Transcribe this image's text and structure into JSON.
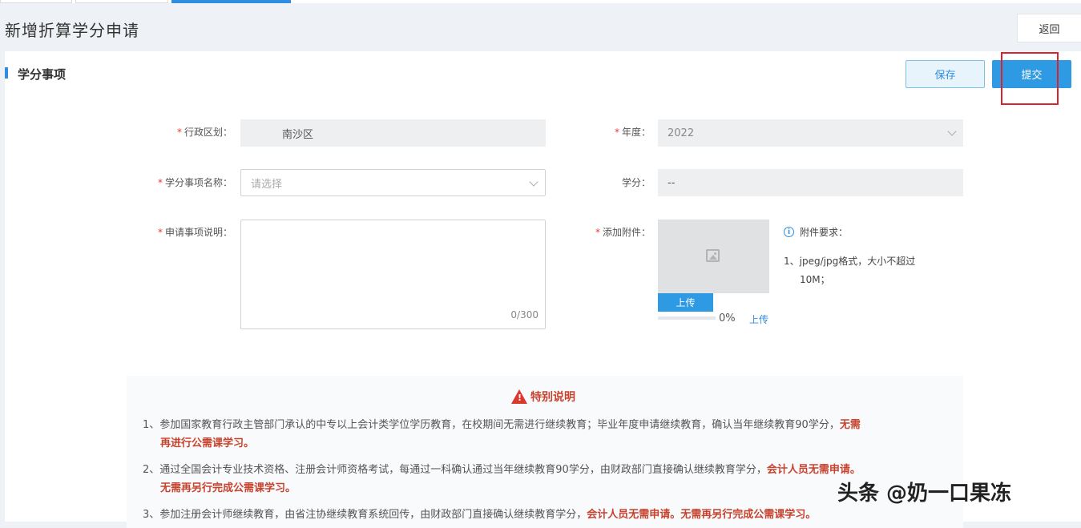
{
  "page": {
    "title": "新增折算学分申请",
    "back_label": "返回"
  },
  "section": {
    "title": "学分事项"
  },
  "toolbar": {
    "save_label": "保存",
    "submit_label": "提交"
  },
  "form": {
    "region": {
      "label": "行政区划：",
      "value": "南沙区",
      "required": "*"
    },
    "year": {
      "label": "年度：",
      "value": "2022",
      "required": "*"
    },
    "item_name": {
      "label": "学分事项名称：",
      "placeholder": "请选择",
      "required": "*"
    },
    "credit": {
      "label": "学分：",
      "value": "--"
    },
    "description": {
      "label": "申请事项说明：",
      "counter": "0/300",
      "required": "*"
    },
    "attachment": {
      "label": "添加附件：",
      "required": "*",
      "upload_label": "上传",
      "progress_text": "0%",
      "progress_value": 0,
      "progress_upload_label": "上传"
    }
  },
  "attachment_requirements": {
    "title": "附件要求：",
    "items": [
      "1、jpeg/jpg格式，大小不超过",
      "10M；"
    ]
  },
  "notice": {
    "title": "特别说明",
    "items": [
      {
        "text": "1、参加国家教育行政主管部门承认的中专以上会计类学位学历教育，在校期间无需进行继续教育；毕业年度申请继续教育，确认当年继续教育90学分，",
        "highlight": "无需",
        "line2": "再进行公需课学习。"
      },
      {
        "text": "2、通过全国会计专业技术资格、注册会计师资格考试，每通过一科确认通过当年继续教育90学分，由财政部门直接确认继续教育学分，",
        "highlight": "会计人员无需申请。",
        "line2": "无需再另行完成公需课学习。"
      },
      {
        "text": "3、参加注册会计师继续教育，由省注协继续教育系统回传，由财政部门直接确认继续教育学分，",
        "highlight": "会计人员无需申请。无需再另行完成公需课学习。"
      }
    ]
  },
  "watermark": "头条 @奶一口果冻",
  "colors": {
    "accent": "#2f9ae4",
    "warning": "#c8432e",
    "highlight_box": "#d9232e"
  }
}
